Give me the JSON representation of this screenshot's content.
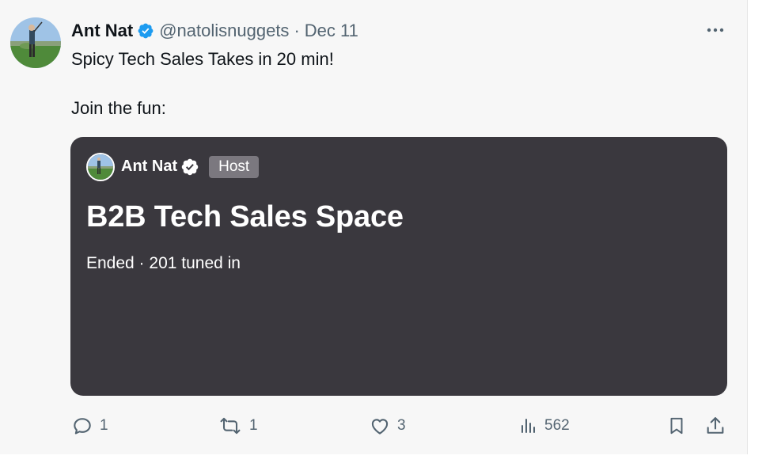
{
  "tweet": {
    "author_name": "Ant Nat",
    "handle": "@natolisnuggets",
    "separator": "·",
    "date": "Dec 11",
    "text_line1": "Spicy Tech Sales Takes in 20 min!",
    "text_line2": "Join the fun:"
  },
  "space_card": {
    "host_name": "Ant Nat",
    "host_badge": "Host",
    "title": "B2B Tech Sales Space",
    "status": "Ended · 201 tuned in"
  },
  "actions": {
    "reply_count": "1",
    "retweet_count": "1",
    "like_count": "3",
    "views_count": "562"
  },
  "colors": {
    "verified": "#1d9bf0",
    "card_background": "#3a383e",
    "secondary_text": "#536471"
  },
  "icons": {
    "more": "more-icon",
    "reply": "reply-icon",
    "retweet": "retweet-icon",
    "like": "heart-icon",
    "views": "views-icon",
    "bookmark": "bookmark-icon",
    "share": "share-icon"
  }
}
